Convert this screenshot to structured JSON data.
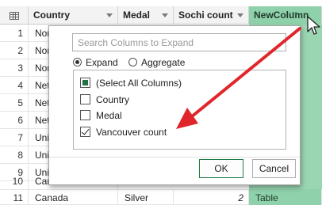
{
  "columns": {
    "country": "Country",
    "medal": "Medal",
    "sochi": "Sochi count",
    "newcol": "NewColumn"
  },
  "rows": [
    {
      "n": "1",
      "country": "Nor"
    },
    {
      "n": "2",
      "country": "Nor"
    },
    {
      "n": "3",
      "country": "Nor"
    },
    {
      "n": "4",
      "country": "Net"
    },
    {
      "n": "5",
      "country": "Net"
    },
    {
      "n": "6",
      "country": "Net"
    },
    {
      "n": "7",
      "country": "Uni"
    },
    {
      "n": "8",
      "country": "Uni"
    },
    {
      "n": "9",
      "country": "Uni"
    },
    {
      "n": "10",
      "country": "Can"
    }
  ],
  "last_row": {
    "n": "11",
    "country": "Canada",
    "medal": "Silver",
    "sochi": "2",
    "newcol": "Table"
  },
  "icons": {
    "table": "table-icon",
    "expand": "expand-icon",
    "cursor": "mouse-pointer-icon",
    "dropdown": "chevron-down-icon"
  },
  "popup": {
    "search_placeholder": "Search Columns to Expand",
    "expand_label": "Expand",
    "aggregate_label": "Aggregate",
    "mode": "Expand",
    "items": [
      {
        "label": "(Select All Columns)",
        "state": "partial"
      },
      {
        "label": "Country",
        "state": "unchecked"
      },
      {
        "label": "Medal",
        "state": "unchecked"
      },
      {
        "label": "Vancouver count",
        "state": "checked"
      }
    ],
    "ok_label": "OK",
    "cancel_label": "Cancel"
  },
  "colors": {
    "new_column": "#8fd1aa",
    "annotation_arrow": "#e0262b",
    "checkbox_partial": "#217346"
  }
}
